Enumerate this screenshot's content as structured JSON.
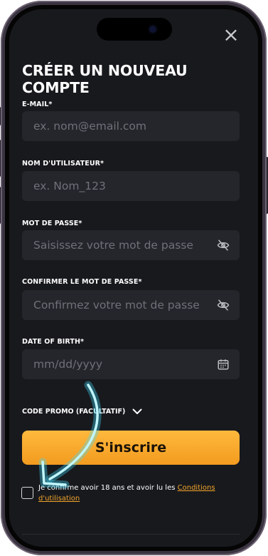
{
  "header": {
    "close_icon": "×",
    "title": "CRÉER UN NOUVEAU COMPTE"
  },
  "form": {
    "email": {
      "label": "E-MAIL*",
      "placeholder": "ex. nom@email.com",
      "value": ""
    },
    "username": {
      "label": "NOM D'UTILISATEUR*",
      "placeholder": "ex. Nom_123",
      "value": ""
    },
    "password": {
      "label": "MOT DE PASSE*",
      "placeholder": "Saisissez votre mot de passe",
      "value": "",
      "icon": "eye-slash-icon"
    },
    "confirm_password": {
      "label": "CONFIRMER LE MOT DE PASSE*",
      "placeholder": "Confirmez votre mot de passe",
      "value": "",
      "icon": "eye-slash-icon"
    },
    "dob": {
      "label": "DATE OF BIRTH*",
      "placeholder": "mm/dd/yyyy",
      "value": "",
      "icon": "calendar-icon"
    },
    "promo": {
      "label": "CODE PROMO (FACULTATIF)",
      "icon": "chevron-down-icon"
    },
    "submit_label": "S'inscrire",
    "terms": {
      "text": "Je confirme avoir 18 ans et avoir lu les ",
      "link": "Conditions d'utilisation",
      "checked": false
    }
  },
  "colors": {
    "background": "#18191d",
    "field": "#25262c",
    "accent": "#f7a928",
    "link": "#f3a52a",
    "arrow": "#3fdcff"
  }
}
